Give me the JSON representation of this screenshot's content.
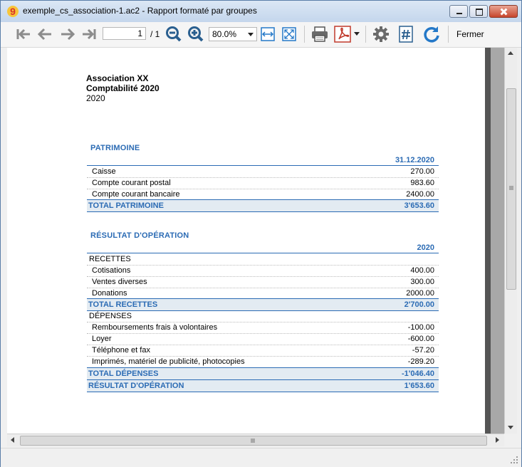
{
  "window": {
    "title": "exemple_cs_association-1.ac2 - Rapport formaté par groupes",
    "logo_text": "9"
  },
  "toolbar": {
    "page_current": "1",
    "page_total": "/ 1",
    "zoom": "80.0%",
    "close_label": "Fermer",
    "colors": {
      "icon_gray": "#7a7a7a",
      "zoom_blue": "#2a5f8f",
      "pdf_red": "#c0392b",
      "refresh_blue": "#2478c8"
    }
  },
  "report": {
    "org": "Association XX",
    "title": "Comptabilité 2020",
    "year": "2020",
    "accent_color": "#2b6bb4",
    "patrimoine": {
      "section": "PATRIMOINE",
      "column": "31.12.2020",
      "rows": [
        {
          "label": "Caisse",
          "value": "270.00"
        },
        {
          "label": "Compte courant postal",
          "value": "983.60"
        },
        {
          "label": "Compte courant bancaire",
          "value": "2400.00"
        }
      ],
      "total_label": "TOTAL PATRIMOINE",
      "total_value": "3'653.60"
    },
    "resultat": {
      "section": "RÉSULTAT D'OPÉRATION",
      "column": "2020",
      "recettes_label": "RECETTES",
      "recettes": [
        {
          "label": "Cotisations",
          "value": "400.00"
        },
        {
          "label": "Ventes diverses",
          "value": "300.00"
        },
        {
          "label": "Donations",
          "value": "2000.00"
        }
      ],
      "total_recettes_label": "TOTAL RECETTES",
      "total_recettes_value": "2'700.00",
      "depenses_label": "DÉPENSES",
      "depenses": [
        {
          "label": "Remboursements frais à volontaires",
          "value": "-100.00"
        },
        {
          "label": "Loyer",
          "value": "-600.00"
        },
        {
          "label": "Téléphone et fax",
          "value": "-57.20"
        },
        {
          "label": "Imprimés, matériel de publicité, photocopies",
          "value": "-289.20"
        }
      ],
      "total_depenses_label": "TOTAL DÉPENSES",
      "total_depenses_value": "-1'046.40",
      "result_label": "RÉSULTAT D'OPÉRATION",
      "result_value": "1'653.60"
    }
  }
}
